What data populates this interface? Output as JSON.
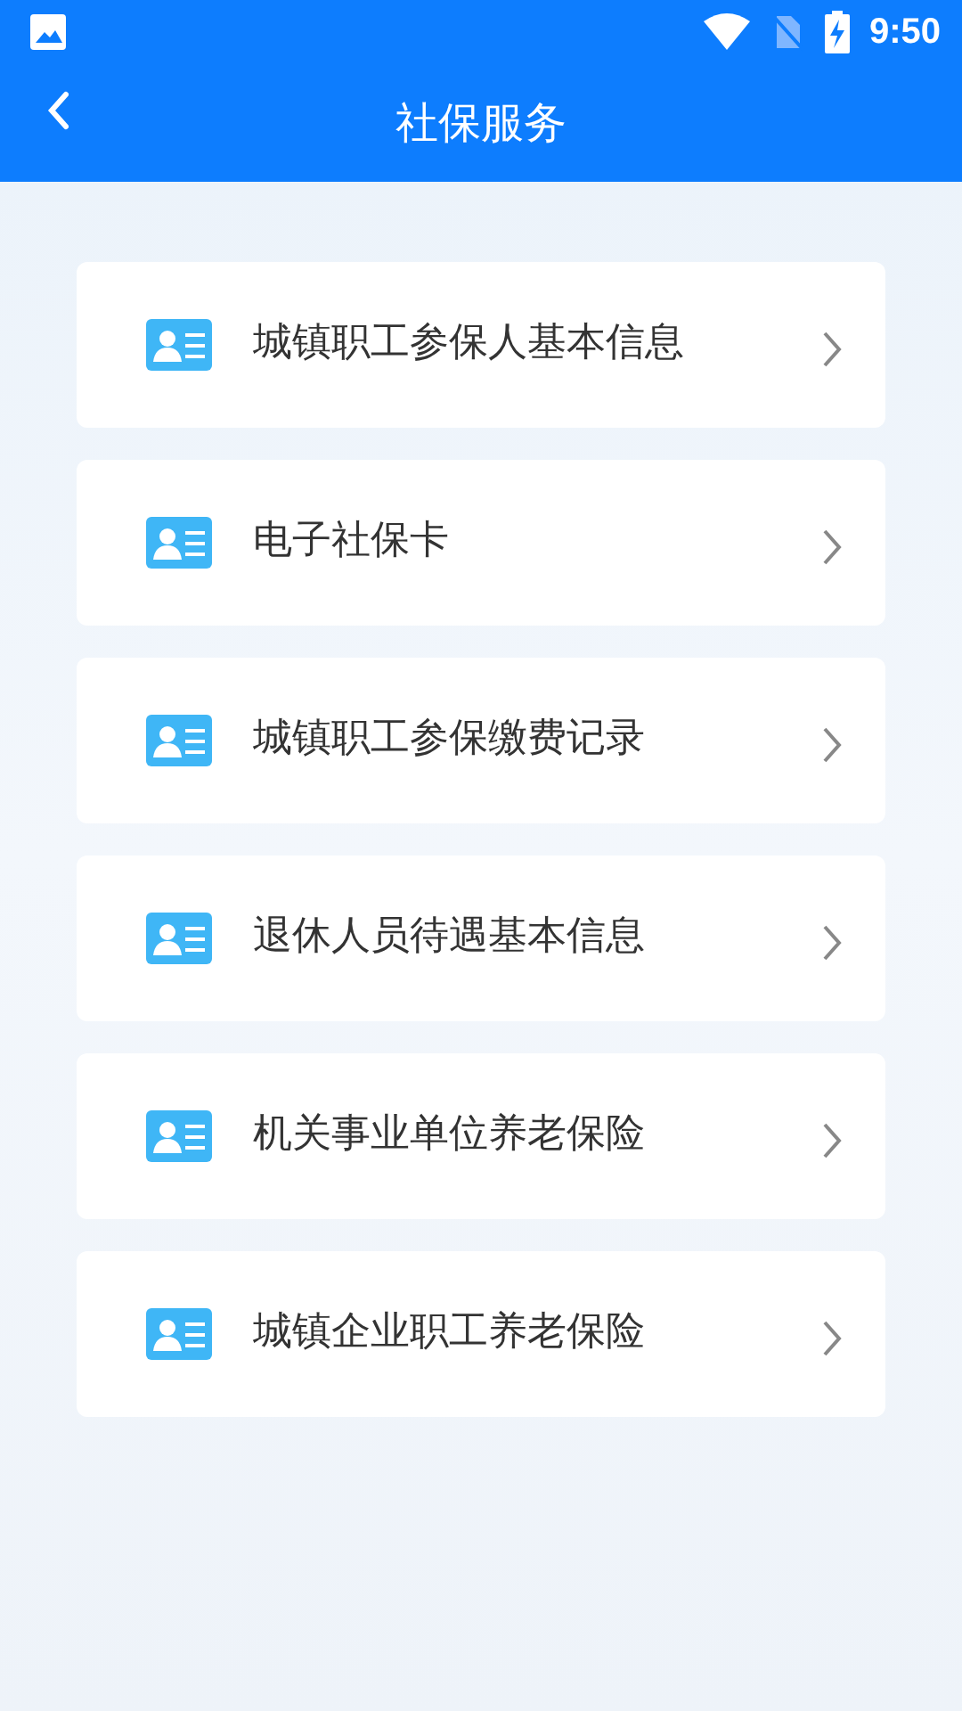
{
  "status_bar": {
    "time": "9:50"
  },
  "header": {
    "title": "社保服务"
  },
  "menu_items": [
    {
      "label": "城镇职工参保人基本信息"
    },
    {
      "label": "电子社保卡"
    },
    {
      "label": "城镇职工参保缴费记录"
    },
    {
      "label": "退休人员待遇基本信息"
    },
    {
      "label": "机关事业单位养老保险"
    },
    {
      "label": "城镇企业职工养老保险"
    }
  ]
}
